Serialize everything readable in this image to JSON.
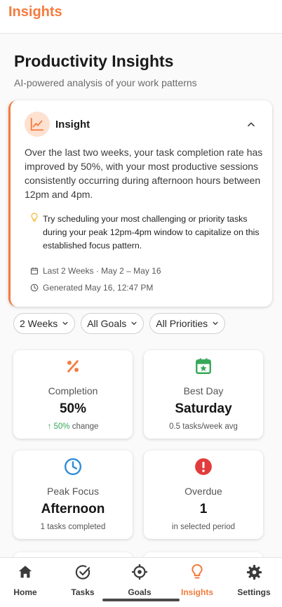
{
  "app": {
    "title": "Insights"
  },
  "page": {
    "title": "Productivity Insights",
    "subtitle": "AI-powered analysis of your work patterns"
  },
  "insight": {
    "title": "Insight",
    "icon": "trending-chart-icon",
    "body": "Over the last two weeks, your task completion rate has improved by 50%, with your most productive sessions consistently occurring during afternoon hours between 12pm and 4pm.",
    "tip": "Try scheduling your most challenging or priority tasks during your peak 12pm-4pm window to capitalize on this established focus pattern.",
    "period": "Last 2 Weeks · May 2 – May 16",
    "generated": "Generated May 16, 12:47 PM"
  },
  "filters": [
    {
      "label": "2 Weeks"
    },
    {
      "label": "All Goals"
    },
    {
      "label": "All Priorities"
    }
  ],
  "stats": {
    "completion": {
      "label": "Completion",
      "value": "50%",
      "sub_highlight": "↑ 50%",
      "sub_rest": " change",
      "icon": "percent-icon"
    },
    "best_day": {
      "label": "Best Day",
      "value": "Saturday",
      "sub": "0.5 tasks/week avg",
      "icon": "calendar-star-icon"
    },
    "peak_focus": {
      "label": "Peak Focus",
      "value": "Afternoon",
      "sub": "1 tasks completed",
      "icon": "clock-icon"
    },
    "overdue": {
      "label": "Overdue",
      "value": "1",
      "sub": "in selected period",
      "icon": "alert-icon"
    }
  },
  "nav": {
    "items": [
      {
        "label": "Home",
        "icon": "home-icon"
      },
      {
        "label": "Tasks",
        "icon": "check-circle-icon"
      },
      {
        "label": "Goals",
        "icon": "target-icon"
      },
      {
        "label": "Insights",
        "icon": "lightbulb-icon",
        "active": true
      },
      {
        "label": "Settings",
        "icon": "gear-icon"
      }
    ]
  },
  "colors": {
    "accent": "#f47b3e",
    "success": "#38a85a",
    "info": "#2f8bd6",
    "danger": "#e23b3b"
  }
}
